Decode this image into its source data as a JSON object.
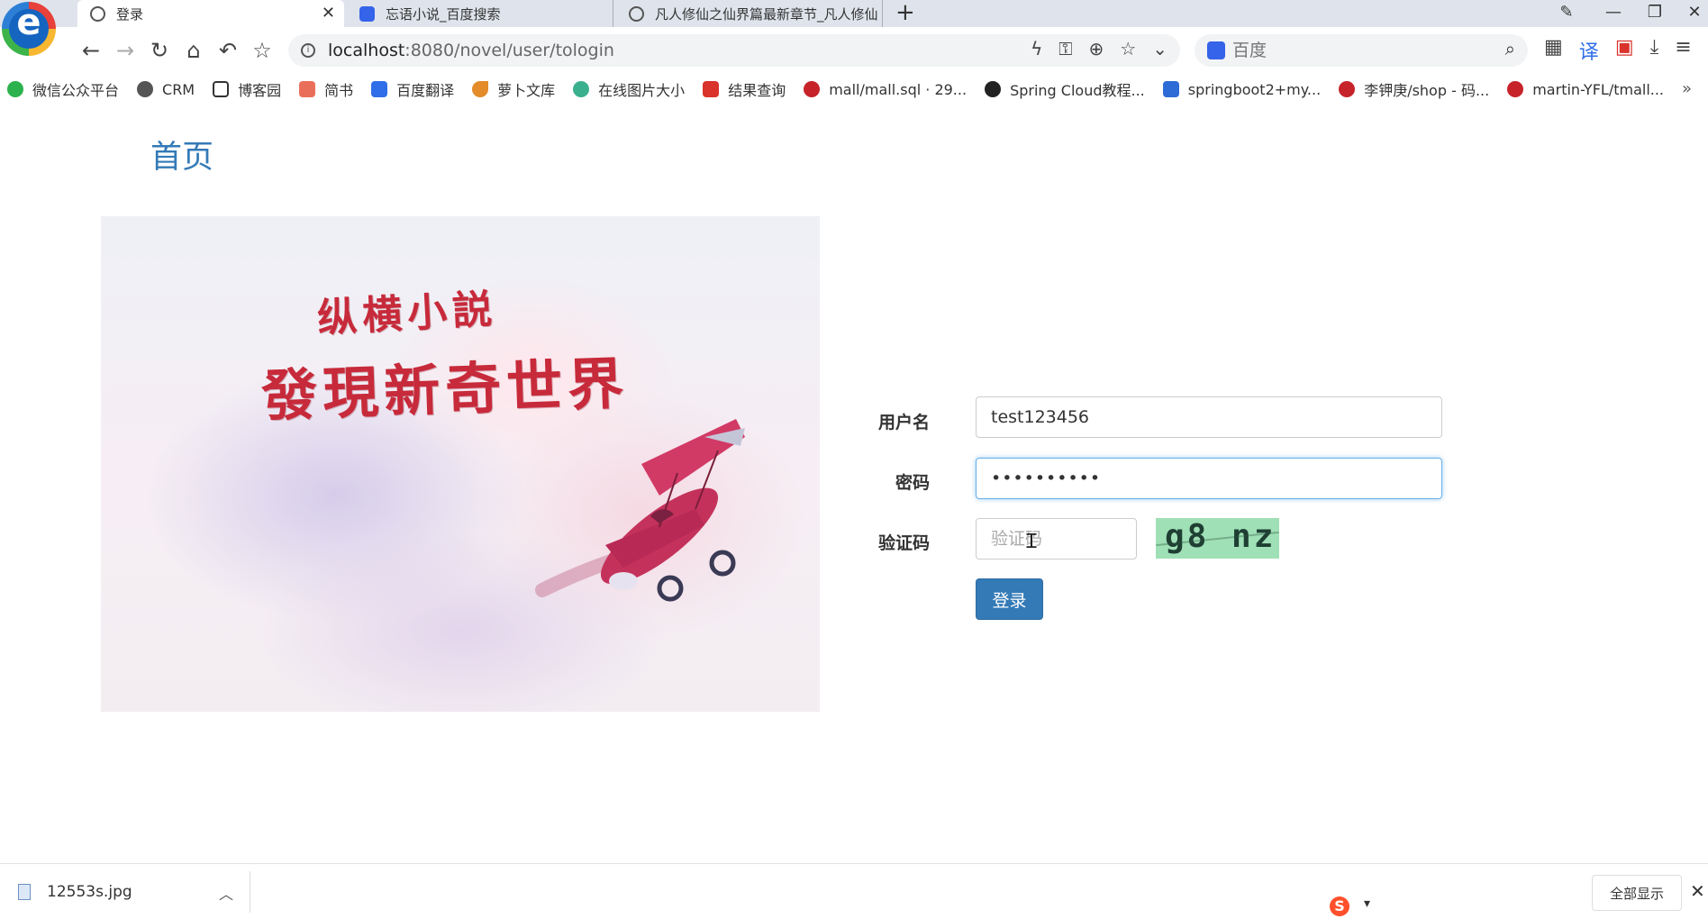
{
  "browser": {
    "tabs": [
      {
        "label": "登录",
        "active": true
      },
      {
        "label": "忘语小说_百度搜索",
        "active": false
      },
      {
        "label": "凡人修仙之仙界篇最新章节_凡人修仙",
        "active": false
      }
    ],
    "tab_close_glyph": "✕",
    "new_tab_glyph": "+",
    "address": {
      "host": "localhost",
      "rest": ":8080/novel/user/tologin"
    },
    "search_placeholder": "百度",
    "bookmarks": [
      {
        "label": "微信公众平台",
        "color": "#2bb24c"
      },
      {
        "label": "CRM",
        "color": "#555555"
      },
      {
        "label": "博客园",
        "color": "#333333"
      },
      {
        "label": "简书",
        "color": "#ea6f5a"
      },
      {
        "label": "百度翻译",
        "color": "#2f6ee8"
      },
      {
        "label": "萝卜文库",
        "color": "#e48b2a"
      },
      {
        "label": "在线图片大小",
        "color": "#3bb08f"
      },
      {
        "label": "结果查询",
        "color": "#d9332c"
      },
      {
        "label": "mall/mall.sql · 29...",
        "color": "#c7232b"
      },
      {
        "label": "Spring Cloud教程...",
        "color": "#222222"
      },
      {
        "label": "springboot2+my...",
        "color": "#2d6bd6"
      },
      {
        "label": "李钾庚/shop - 码...",
        "color": "#c7232b"
      },
      {
        "label": "martin-YFL/tmall...",
        "color": "#c7232b"
      }
    ],
    "bookmarks_more": "»"
  },
  "page": {
    "home_link": "首页",
    "banner": {
      "line1": "纵横小説",
      "line2": "發現新奇世界"
    },
    "form": {
      "username_label": "用户名",
      "username_value": "test123456",
      "password_label": "密码",
      "password_value": "••••••••••",
      "captcha_label": "验证码",
      "captcha_placeholder": "验证码",
      "captcha_image_text": "g8 nz",
      "login_button": "登录"
    }
  },
  "downloads": {
    "file_name": "12553s.jpg",
    "show_all": "全部显示",
    "close_glyph": "✕",
    "sogou_glyph": "S"
  },
  "colors": {
    "accent": "#337ab7",
    "captcha_bg": "#9fe0b6"
  }
}
